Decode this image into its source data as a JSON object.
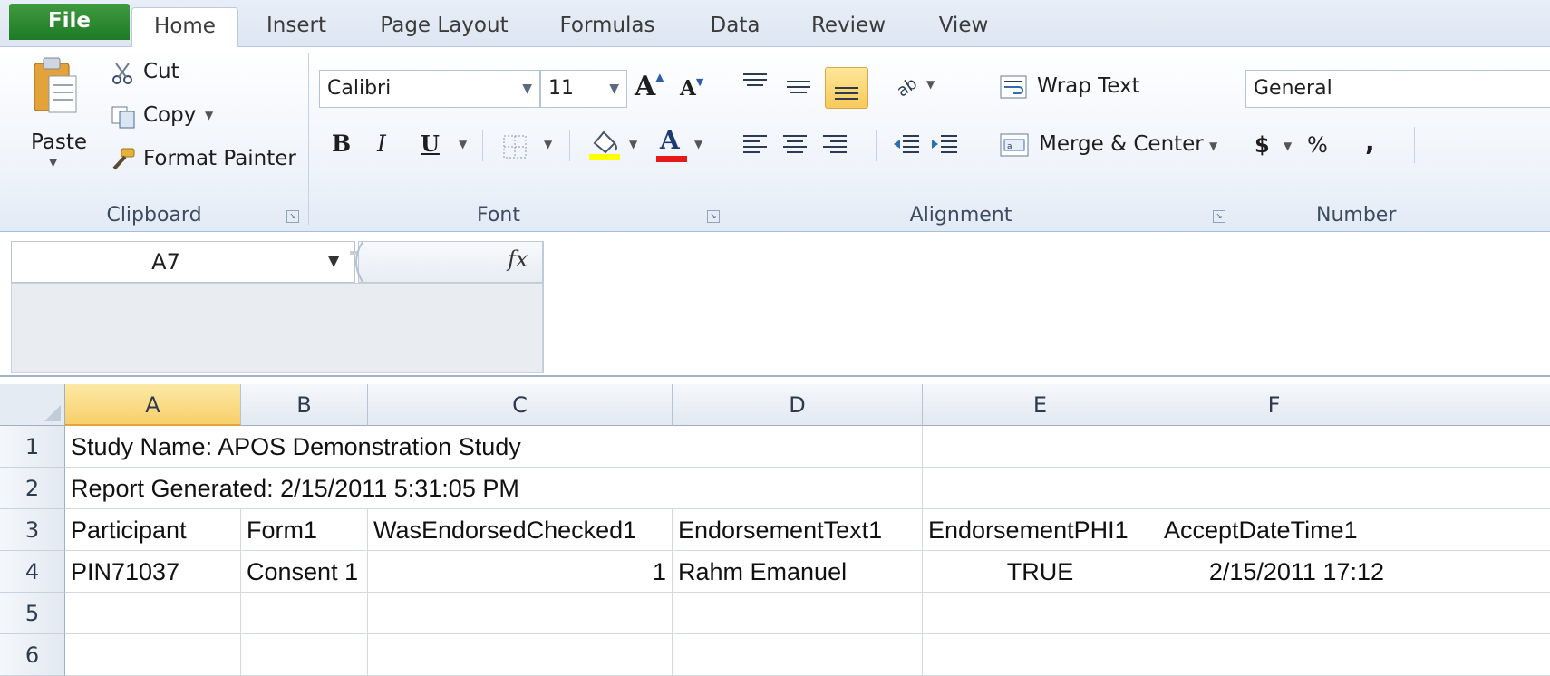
{
  "tabs": [
    {
      "label": "File"
    },
    {
      "label": "Home"
    },
    {
      "label": "Insert"
    },
    {
      "label": "Page Layout"
    },
    {
      "label": "Formulas"
    },
    {
      "label": "Data"
    },
    {
      "label": "Review"
    },
    {
      "label": "View"
    }
  ],
  "clipboard": {
    "paste": "Paste",
    "cut": "Cut",
    "copy": "Copy",
    "format_painter": "Format Painter",
    "group": "Clipboard"
  },
  "font": {
    "name": "Calibri",
    "size": "11",
    "group": "Font",
    "bold": "B",
    "italic": "I",
    "underline": "U",
    "font_color_letter": "A",
    "grow": "A",
    "shrink": "A"
  },
  "alignment": {
    "wrap": "Wrap Text",
    "merge": "Merge & Center",
    "group": "Alignment"
  },
  "number": {
    "format": "General",
    "currency": "$",
    "percent": "%",
    "comma": ",",
    "group": "Number"
  },
  "formula_bar": {
    "name_box": "A7",
    "fx": "fx"
  },
  "columns": [
    "A",
    "B",
    "C",
    "D",
    "E",
    "F"
  ],
  "rows": [
    "1",
    "2",
    "3",
    "4",
    "5",
    "6"
  ],
  "cells": {
    "r1": {
      "a": "Study Name: APOS Demonstration Study"
    },
    "r2": {
      "a": "Report Generated: 2/15/2011 5:31:05 PM"
    },
    "r3": {
      "a": "Participant",
      "b": "Form1",
      "c": "WasEndorsedChecked1",
      "d": "EndorsementText1",
      "e": "EndorsementPHI1",
      "f": "AcceptDateTime1"
    },
    "r4": {
      "a": "PIN71037",
      "b": "Consent 1",
      "c": "1",
      "d": "Rahm Emanuel",
      "e": "TRUE",
      "f": "2/15/2011 17:12"
    }
  },
  "colors": {
    "file_tab": "#2a8a2f",
    "selection": "#f8cf6a",
    "ribbon_bg": "#eef3fa"
  }
}
